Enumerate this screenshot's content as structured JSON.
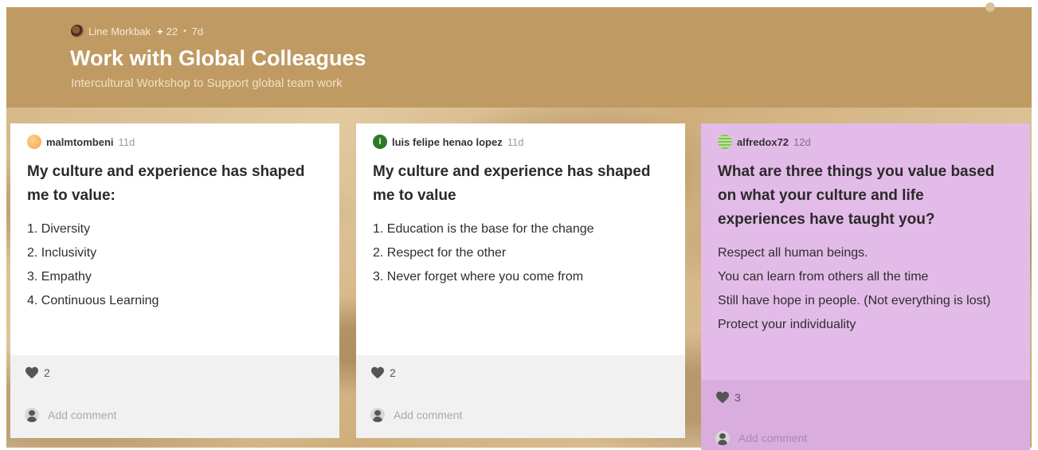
{
  "header": {
    "author": "Line Morkbak",
    "contributors_prefix": "+",
    "contributors": "22",
    "separator": "•",
    "age": "7d",
    "title": "Work with Global Colleagues",
    "subtitle": "Intercultural Workshop to Support global team work",
    "color": "#bf9a62"
  },
  "posts": [
    {
      "author": "malmtombeni",
      "age": "11d",
      "title": "My culture and experience has shaped me to value:",
      "body": [
        "1. Diversity",
        "2. Inclusivity",
        "3. Empathy",
        "4. Continuous Learning"
      ],
      "likes": "2",
      "comment_placeholder": "Add comment",
      "avatar": "orange-circle",
      "color": "#ffffff"
    },
    {
      "author": "luis felipe henao lopez",
      "age": "11d",
      "avatar_initial": "l",
      "title": "My culture and experience has shaped me to value",
      "body": [
        "1. Education is the base for the change",
        "2. Respect for the other",
        "3. Never forget where you come from"
      ],
      "likes": "2",
      "comment_placeholder": "Add comment",
      "avatar": "green-circle",
      "color": "#ffffff"
    },
    {
      "author": "alfredox72",
      "age": "12d",
      "title": "What are three things you value based on what your culture and life experiences have taught you?",
      "body": [
        "Respect all human beings.",
        "You can learn from others all the time",
        "Still have hope in people. (Not everything is lost)",
        "Protect your individuality"
      ],
      "likes": "3",
      "comment_placeholder": "Add comment",
      "avatar": "striped-circle",
      "color": "#e3bbe8"
    }
  ],
  "icons": {
    "like": "heart-icon",
    "comment": "user-avatar-icon"
  }
}
